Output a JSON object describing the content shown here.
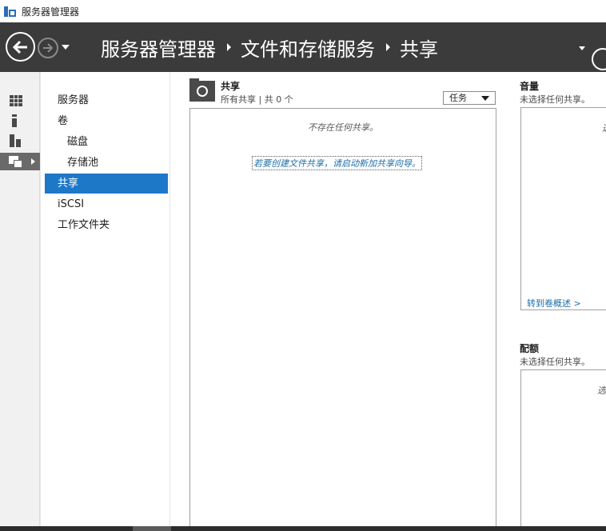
{
  "window": {
    "title": "服务器管理器",
    "icon": "server-manager-icon"
  },
  "header": {
    "breadcrumb": [
      "服务器管理器",
      "文件和存储服务",
      "共享"
    ],
    "back_icon": "back-arrow-icon",
    "forward_icon": "forward-arrow-icon",
    "refresh_icon": "refresh-icon"
  },
  "rail": {
    "items": [
      {
        "icon": "dashboard-icon"
      },
      {
        "icon": "local-server-icon"
      },
      {
        "icon": "all-servers-icon"
      },
      {
        "icon": "file-storage-icon",
        "active": true
      }
    ]
  },
  "sidebar": {
    "items": [
      {
        "label": "服务器",
        "level": 0
      },
      {
        "label": "卷",
        "level": 0
      },
      {
        "label": "磁盘",
        "level": 1
      },
      {
        "label": "存储池",
        "level": 1
      },
      {
        "label": "共享",
        "level": 0,
        "active": true
      },
      {
        "label": "iSCSI",
        "level": 0
      },
      {
        "label": "工作文件夹",
        "level": 0
      }
    ]
  },
  "shares": {
    "title": "共享",
    "subtitle": "所有共享 | 共 0 个",
    "tasks_label": "任务",
    "empty_message": "不存在任何共享。",
    "create_link": "若要创建文件共享，请启动新加共享向导。"
  },
  "volume_panel": {
    "title": "音量",
    "subtitle": "未选择任何共享。",
    "partial_text": "选",
    "link": "转到卷概述 >"
  },
  "quota_panel": {
    "title": "配额",
    "subtitle": "未选择任何共享。",
    "partial_text": "选"
  },
  "colors": {
    "header_bg": "#3b3b3b",
    "accent": "#1e78c8",
    "link": "#1e6ea8"
  }
}
